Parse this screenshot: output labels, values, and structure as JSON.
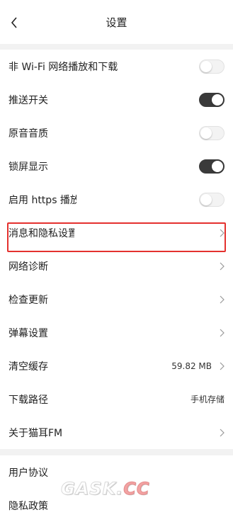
{
  "header": {
    "title": "设置"
  },
  "settings": {
    "wifi_play_download": {
      "label": "非 Wi-Fi 网络播放和下载",
      "enabled": false
    },
    "push_switch": {
      "label": "推送开关",
      "enabled": true
    },
    "original_sound": {
      "label": "原音音质",
      "enabled": false
    },
    "lockscreen_display": {
      "label": "锁屏显示",
      "enabled": true
    },
    "https_play": {
      "label": "启用 https 播放",
      "enabled": false
    },
    "message_privacy": {
      "label": "消息和隐私设置"
    },
    "network_diagnosis": {
      "label": "网络诊断"
    },
    "check_update": {
      "label": "检查更新"
    },
    "danmaku_settings": {
      "label": "弹幕设置"
    },
    "clear_cache": {
      "label": "清空缓存",
      "value": "59.82 MB"
    },
    "download_path": {
      "label": "下载路径",
      "value": "手机存储"
    },
    "about": {
      "label": "关于猫耳FM"
    },
    "user_agreement": {
      "label": "用户协议"
    },
    "privacy_policy": {
      "label": "隐私政策"
    }
  },
  "watermark": {
    "text_main": "GASK.",
    "text_accent": "CC"
  },
  "colors": {
    "toggle_on": "#3a3a3a",
    "highlight": "#e4312e"
  },
  "icons": {
    "back": "chevron-left-icon",
    "row_arrow": "chevron-right-icon"
  }
}
